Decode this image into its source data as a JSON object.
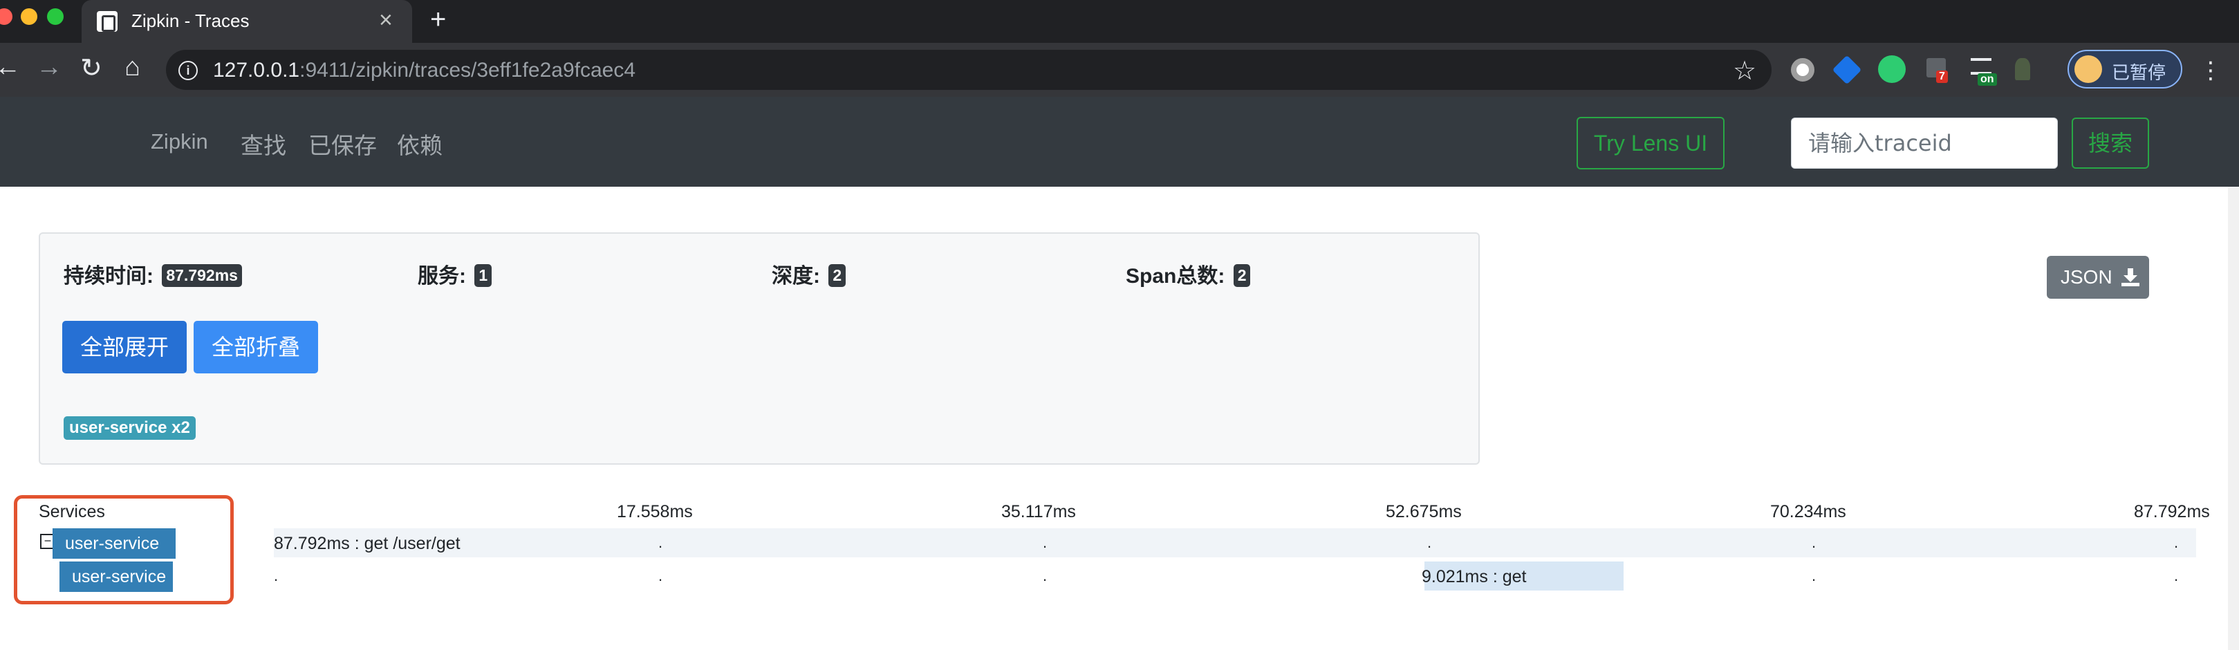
{
  "browser": {
    "tab_title": "Zipkin - Traces",
    "url_host": "127.0.0.1",
    "url_rest": ":9411/zipkin/traces/3eff1fe2a9fcaec4",
    "profile_label": "已暂停",
    "extension_badges": [
      "7",
      "on"
    ]
  },
  "navbar": {
    "brand": "Zipkin",
    "links": [
      "查找",
      "已保存",
      "依赖"
    ],
    "lens_button": "Try Lens UI",
    "search_placeholder": "请输入traceid",
    "search_button": "搜索"
  },
  "summary": {
    "duration_label": "持续时间:",
    "duration_value": "87.792ms",
    "services_label": "服务:",
    "services_value": "1",
    "depth_label": "深度:",
    "depth_value": "2",
    "spans_label": "Span总数:",
    "spans_value": "2",
    "json_button": "JSON",
    "expand_all": "全部展开",
    "collapse_all": "全部折叠",
    "service_pill": "user-service x2"
  },
  "timeline": {
    "services_header": "Services",
    "ticks": [
      "17.558ms",
      "35.117ms",
      "52.675ms",
      "70.234ms",
      "87.792ms"
    ],
    "rows": [
      {
        "service": "user-service",
        "span_label": "87.792ms : get /user/get"
      },
      {
        "service": "user-service",
        "span_label": "9.021ms : get"
      }
    ],
    "collapse_symbol": "−"
  },
  "colors": {
    "navbar_bg": "#343a40",
    "accent_green": "#28a745",
    "service_blue": "#337fb5",
    "highlight_red": "#e2532f"
  }
}
